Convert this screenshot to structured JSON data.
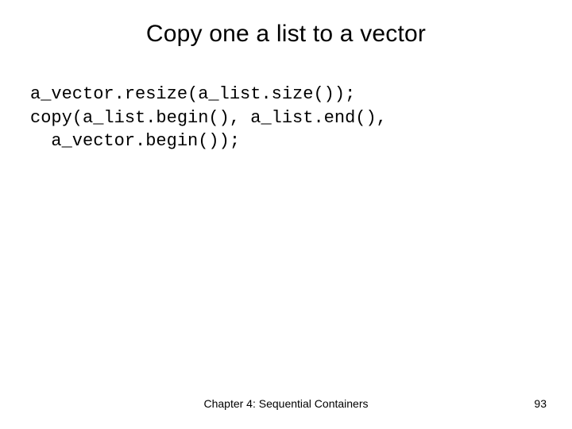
{
  "title": "Copy one a list to a vector",
  "code": "a_vector.resize(a_list.size());\ncopy(a_list.begin(), a_list.end(),\n  a_vector.begin());",
  "footer": {
    "chapter": "Chapter 4: Sequential Containers",
    "page": "93"
  }
}
